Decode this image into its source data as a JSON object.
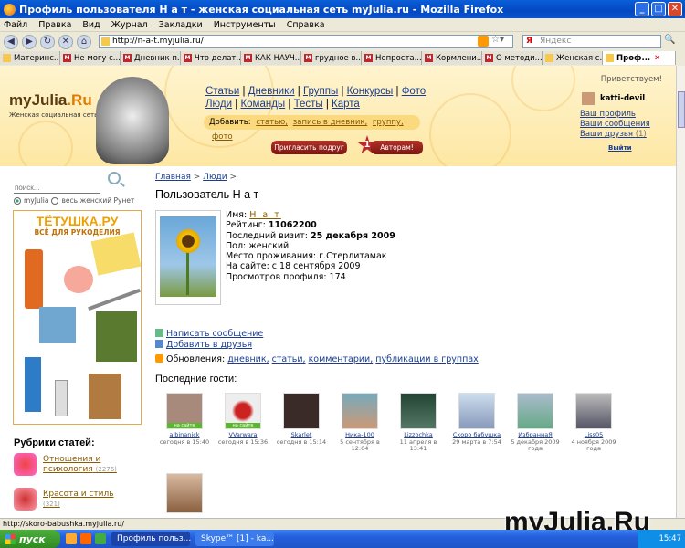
{
  "window": {
    "title": "Профиль пользователя Н а т - женская социальная сеть myJulia.ru - Mozilla Firefox"
  },
  "menu": [
    "Файл",
    "Правка",
    "Вид",
    "Журнал",
    "Закладки",
    "Инструменты",
    "Справка"
  ],
  "url": "http://n-a-t.myjulia.ru/",
  "search_placeholder": "Яндекс",
  "tabs": [
    "Материнс...",
    "Не могу с...",
    "Дневник п...",
    "Что делат...",
    "КАК НАУЧ...",
    "грудное в...",
    "Непроста...",
    "Кормлени...",
    "О методи...",
    "Женская с...",
    "Проф..."
  ],
  "site": {
    "logo_main": "myJulia",
    "logo_suffix": ".Ru",
    "tagline": "Женская социальная сеть",
    "nav_row1": [
      "Статьи",
      "Дневники",
      "Группы",
      "Конкурсы",
      "Фото"
    ],
    "nav_row2": [
      "Люди",
      "Команды",
      "Тесты",
      "Карта"
    ],
    "add_label": "Добавить:",
    "add_links": [
      "статью,",
      "запись в дневник,",
      "группу,",
      "фото"
    ],
    "invite_btn": "Пригласить подруг",
    "authors_btn": "Авторам!",
    "authors_star": "1",
    "welcome": "Приветствуем!",
    "username": "katti-devil",
    "user_links": [
      "Ваш профиль",
      "Ваши сообщения",
      "Ваши друзья"
    ],
    "friends_count": "(1)",
    "logout": "Выйти"
  },
  "sidebar": {
    "search_placeholder": "поиск...",
    "radio1": "myJulia",
    "radio2": "весь женский Рунет",
    "ad_title": "ТЁТУШКА.РУ",
    "ad_subtitle": "ВСЁ ДЛЯ РУКОДЕЛИЯ",
    "rubrics_title": "Рубрики статей:",
    "rubrics": [
      {
        "label1": "Отношения и",
        "label2": "психология",
        "count": "(2276)"
      },
      {
        "label1": "Красота и стиль",
        "label2": "",
        "count": "(321)"
      }
    ]
  },
  "profile": {
    "breadcrumb": [
      "Главная",
      "Люди"
    ],
    "sep": ">",
    "title": "Пользователь Н а т",
    "name_label": "Имя:",
    "name": "Н а т",
    "rating_label": "Рейтинг:",
    "rating": "11062200",
    "last_visit_label": "Последний визит:",
    "last_visit": "25 декабря 2009",
    "gender": "Пол: женский",
    "residence": "Место проживания: г.Стерлитамак",
    "on_site": "На сайте: с 18 сентября 2009",
    "views": "Просмотров профиля: 174",
    "write_msg": "Написать сообщение",
    "add_friend": "Добавить в друзья",
    "updates_label": "Обновления:",
    "updates": [
      "дневник,",
      "статьи,",
      "комментарии,",
      "публикации в группах"
    ],
    "guests_title": "Последние гости:",
    "online_label": "на сайте",
    "guests": [
      {
        "name": "albinanick",
        "time1": "сегодня в 15:40",
        "time2": "",
        "online": true
      },
      {
        "name": "VVarwara",
        "time1": "сегодня в 15:36",
        "time2": "",
        "online": true
      },
      {
        "name": "Skarlet",
        "time1": "сегодня в 15:14",
        "time2": "",
        "online": false
      },
      {
        "name": "Ника-100",
        "time1": "5 сентября в",
        "time2": "12:04",
        "online": false
      },
      {
        "name": "Lizzochka",
        "time1": "11 апреля в",
        "time2": "13:41",
        "online": false
      },
      {
        "name": "Скоро бабушка",
        "time1": "29 марта в 7:54",
        "time2": "",
        "online": false
      },
      {
        "name": "ИзбраннаЯ",
        "time1": "5 декабря 2009",
        "time2": "года",
        "online": false
      },
      {
        "name": "Liss05",
        "time1": "4 ноября 2009",
        "time2": "года",
        "online": false
      }
    ]
  },
  "status_text": "http://skoro-babushka.myjulia.ru/",
  "watermark": "myJulia.Ru",
  "taskbar": {
    "start": "пуск",
    "task1": "Профиль польз...",
    "task2": "Skype™ [1] - ka...",
    "clock": "15:47"
  }
}
